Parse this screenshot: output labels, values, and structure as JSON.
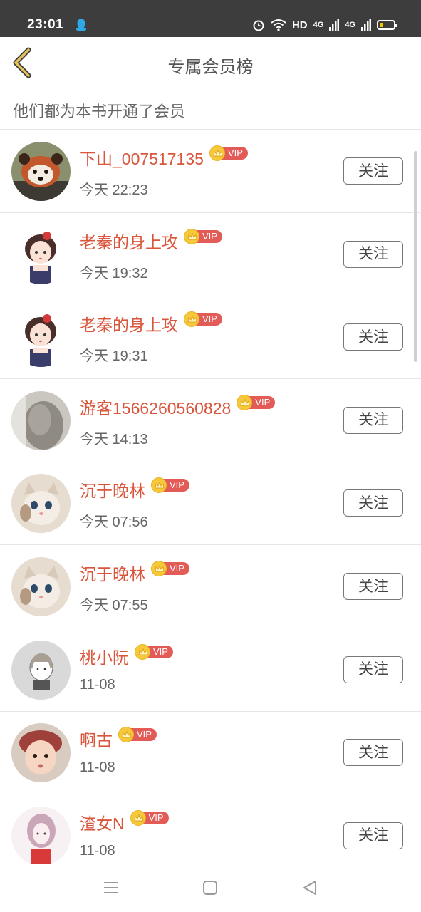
{
  "status_bar": {
    "time": "23:01",
    "network": "HD",
    "signal_1": "4G",
    "signal_2": "4G",
    "icons": [
      "qq-icon",
      "alarm-icon",
      "wifi-icon",
      "signal-icon",
      "battery-icon"
    ]
  },
  "header": {
    "title": "专属会员榜",
    "back_icon": "chevron-left-icon",
    "accent_color": "#d9b84a"
  },
  "subtitle": "他们都为本书开通了会员",
  "vip_label": "VIP",
  "follow_label": "关注",
  "colors": {
    "name": "#d9553b",
    "vip_tag": "#e25b57",
    "crown": "#f6c83b"
  },
  "members": [
    {
      "name": "下山_007517135",
      "time": "今天 22:23",
      "avatar": "red-panda"
    },
    {
      "name": "老秦的身上攻",
      "time": "今天 19:32",
      "avatar": "anime-girl"
    },
    {
      "name": "老秦的身上攻",
      "time": "今天 19:31",
      "avatar": "anime-girl"
    },
    {
      "name": "游客1566260560828",
      "time": "今天 14:13",
      "avatar": "gray-cat"
    },
    {
      "name": "沉于晚林",
      "time": "今天 07:56",
      "avatar": "kitten"
    },
    {
      "name": "沉于晚林",
      "time": "今天 07:55",
      "avatar": "kitten"
    },
    {
      "name": "桃小阮",
      "time": "11-08",
      "avatar": "sketch-girl"
    },
    {
      "name": "啊古",
      "time": "11-08",
      "avatar": "child"
    },
    {
      "name": "渣女N",
      "time": "11-08",
      "avatar": "pink-girl"
    }
  ],
  "nav_bar": {
    "icons": [
      "menu-icon",
      "home-square-icon",
      "back-triangle-icon"
    ]
  }
}
